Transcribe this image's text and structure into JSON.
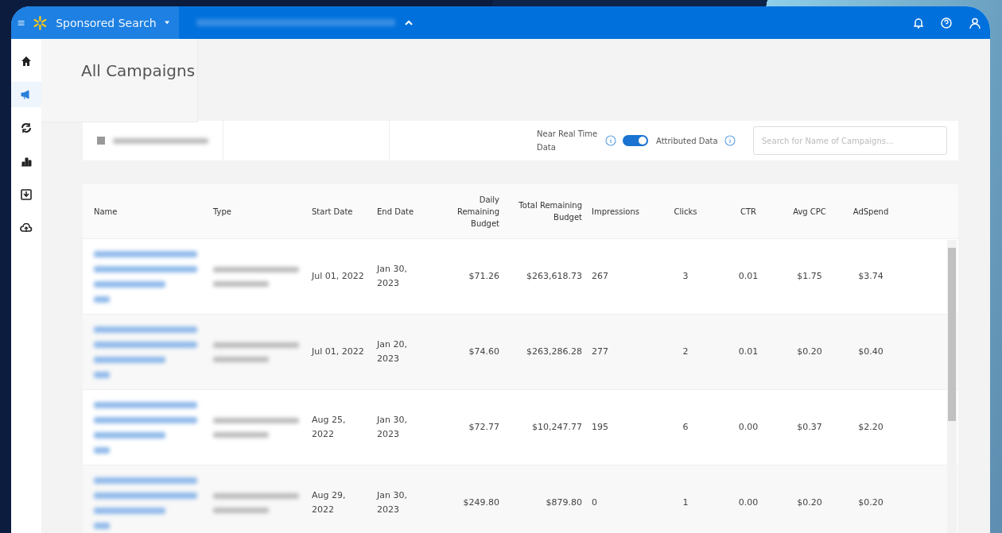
{
  "top_bar": {
    "title": "Sponsored Search",
    "account_menu_expanded": true
  },
  "sidebar": {
    "items": [
      {
        "selected": false
      },
      {
        "selected": true
      },
      {
        "selected": false
      },
      {
        "selected": false
      },
      {
        "selected": false
      },
      {
        "selected": false
      }
    ]
  },
  "page_title": "All Campaigns",
  "filters": {
    "near_real_time_label": "Near Real Time Data",
    "toggle_on": true,
    "attributed_label": "Attributed Data",
    "search": {
      "placeholder": "Search for Name of Campaigns..."
    }
  },
  "table": {
    "columns": [
      "Name",
      "Type",
      "Start Date",
      "End Date",
      "Daily Remaining Budget",
      "Total Remaining Budget",
      "Impressions",
      "Clicks",
      "CTR",
      "Avg CPC",
      "AdSpend"
    ],
    "rows": [
      {
        "start": "Jul 01, 2022",
        "end": "Jan 30, 2023",
        "daily": "$71.26",
        "total": "$263,618.73",
        "impressions": "267",
        "clicks": "3",
        "ctr": "0.01",
        "cpc": "$1.75",
        "spend": "$3.74"
      },
      {
        "start": "Jul 01, 2022",
        "end": "Jan 20, 2023",
        "daily": "$74.60",
        "total": "$263,286.28",
        "impressions": "277",
        "clicks": "2",
        "ctr": "0.01",
        "cpc": "$0.20",
        "spend": "$0.40"
      },
      {
        "start": "Aug 25, 2022",
        "end": "Jan 30, 2023",
        "daily": "$72.77",
        "total": "$10,247.77",
        "impressions": "195",
        "clicks": "6",
        "ctr": "0.00",
        "cpc": "$0.37",
        "spend": "$2.20"
      },
      {
        "start": "Aug 29, 2022",
        "end": "Jan 30, 2023",
        "daily": "$249.80",
        "total": "$879.80",
        "impressions": "0",
        "clicks": "1",
        "ctr": "0.00",
        "cpc": "$0.20",
        "spend": "$0.20"
      }
    ]
  }
}
